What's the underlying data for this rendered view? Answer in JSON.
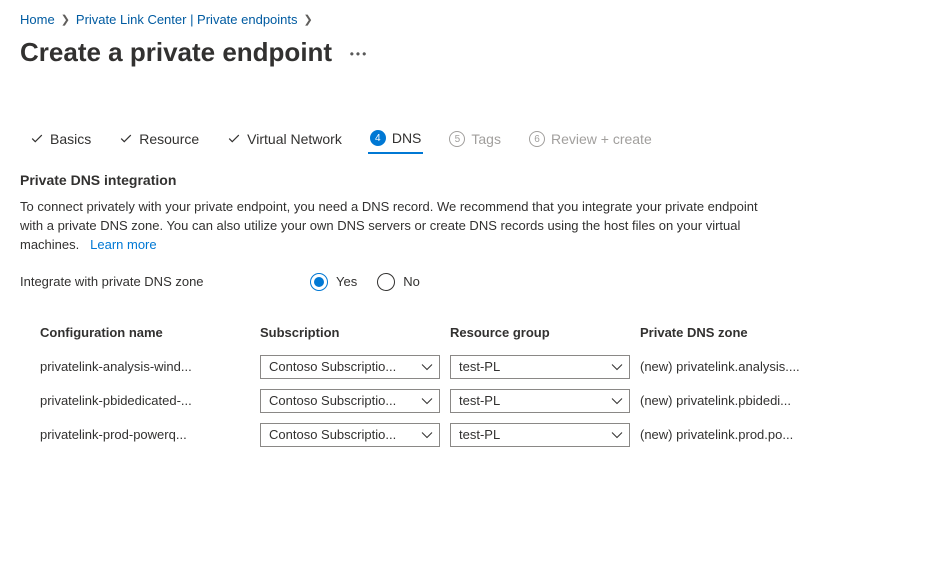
{
  "breadcrumb": {
    "home": "Home",
    "center": "Private Link Center | Private endpoints"
  },
  "header": {
    "title": "Create a private endpoint"
  },
  "tabs": {
    "basics": "Basics",
    "resource": "Resource",
    "vnet": "Virtual Network",
    "dns_num": "4",
    "dns": "DNS",
    "tags_num": "5",
    "tags": "Tags",
    "review_num": "6",
    "review": "Review + create"
  },
  "dns_section": {
    "title": "Private DNS integration",
    "description": "To connect privately with your private endpoint, you need a DNS record. We recommend that you integrate your private endpoint with a private DNS zone. You can also utilize your own DNS servers or create DNS records using the host files on your virtual machines.",
    "learn_more": "Learn more",
    "integrate_label": "Integrate with private DNS zone",
    "option_yes": "Yes",
    "option_no": "No"
  },
  "table": {
    "headers": {
      "config": "Configuration name",
      "sub": "Subscription",
      "rg": "Resource group",
      "zone": "Private DNS zone"
    },
    "rows": [
      {
        "config": "privatelink-analysis-wind...",
        "sub": "Contoso Subscriptio...",
        "rg": "test-PL",
        "zone": "(new) privatelink.analysis...."
      },
      {
        "config": "privatelink-pbidedicated-...",
        "sub": "Contoso Subscriptio...",
        "rg": "test-PL",
        "zone": "(new) privatelink.pbidedi..."
      },
      {
        "config": "privatelink-prod-powerq...",
        "sub": "Contoso Subscriptio...",
        "rg": "test-PL",
        "zone": "(new) privatelink.prod.po..."
      }
    ]
  }
}
